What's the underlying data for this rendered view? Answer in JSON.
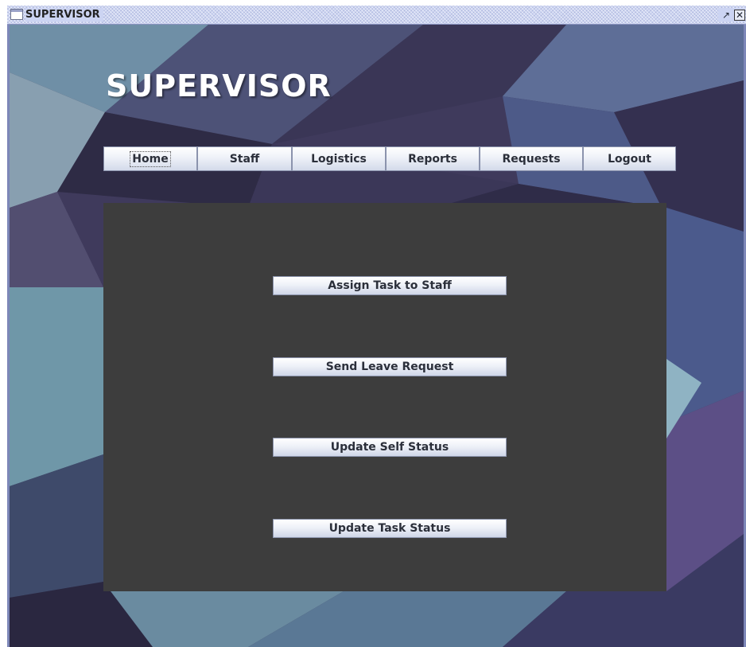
{
  "window": {
    "title": "SUPERVISOR",
    "controls": {
      "restore_icon": "restore-icon",
      "close_icon": "close-icon"
    }
  },
  "header": {
    "title": "SUPERVISOR"
  },
  "nav": {
    "items": [
      {
        "label": "Home",
        "selected": true
      },
      {
        "label": "Staff"
      },
      {
        "label": "Logistics"
      },
      {
        "label": "Reports"
      },
      {
        "label": "Requests"
      },
      {
        "label": "Logout"
      }
    ]
  },
  "actions": [
    {
      "label": "Assign Task to Staff"
    },
    {
      "label": "Send Leave Request"
    },
    {
      "label": "Update Self Status"
    },
    {
      "label": "Update Task Status"
    }
  ],
  "colors": {
    "panel": "#3d3d3d",
    "title_text": "#ffffff",
    "window_bar": "#ccd4f2"
  }
}
